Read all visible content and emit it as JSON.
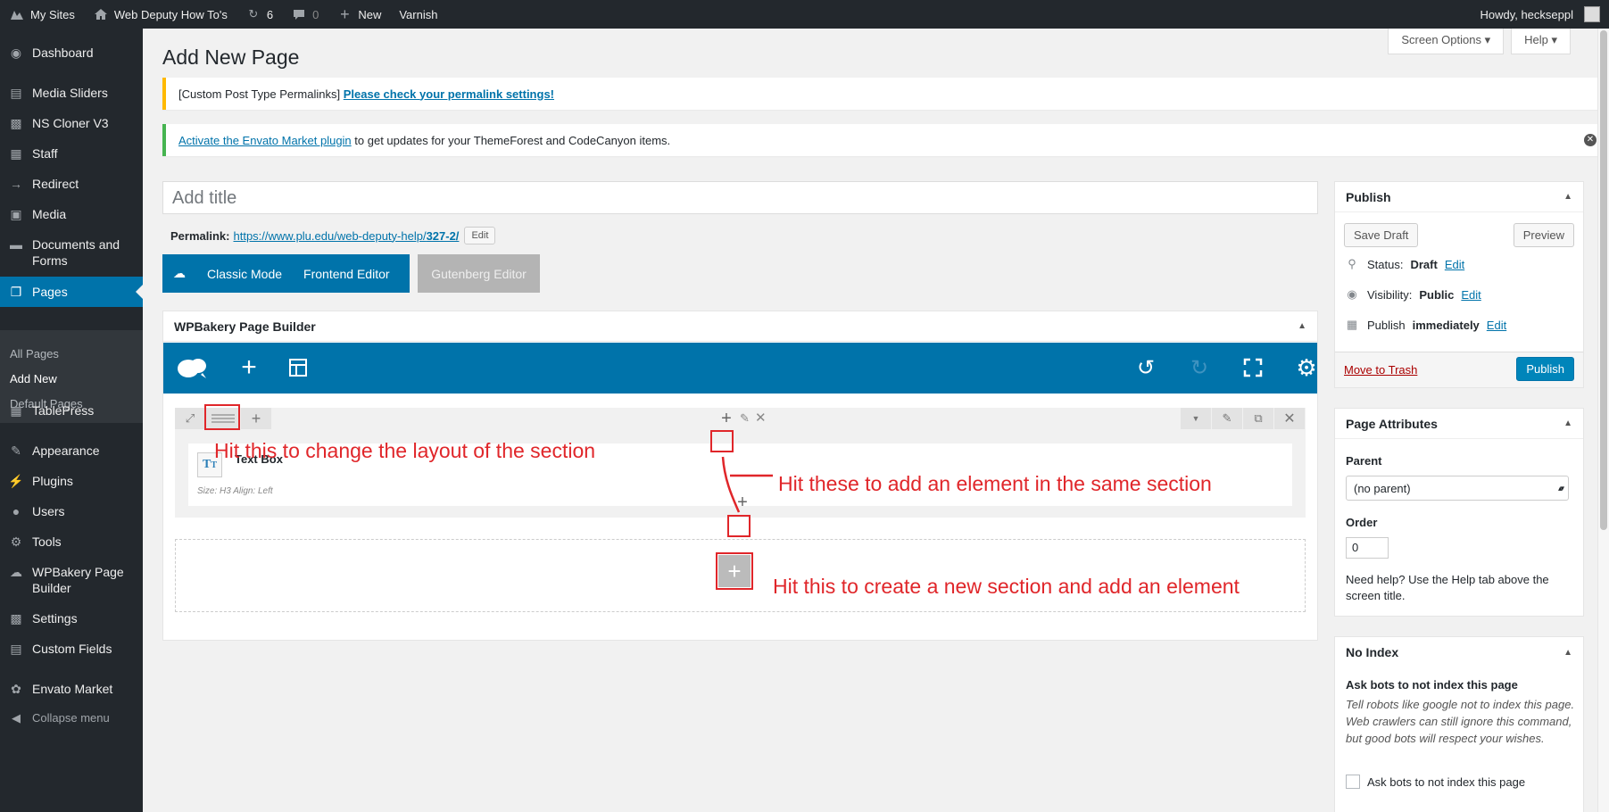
{
  "adminbar": {
    "my_sites": "My Sites",
    "site_name": "Web Deputy How To's",
    "updates_count": "6",
    "comments_count": "0",
    "new_label": "New",
    "varnish": "Varnish",
    "howdy": "Howdy, heckseppl"
  },
  "sidebar": {
    "items": [
      {
        "label": "Dashboard",
        "icon": "dashboard-icon"
      },
      {
        "label": "Media Sliders",
        "icon": "sliders-icon"
      },
      {
        "label": "NS Cloner V3",
        "icon": "cloner-icon"
      },
      {
        "label": "Staff",
        "icon": "staff-icon"
      },
      {
        "label": "Redirect",
        "icon": "arrow-right-icon"
      },
      {
        "label": "Media",
        "icon": "media-icon"
      },
      {
        "label": "Documents and Forms",
        "icon": "folder-icon"
      },
      {
        "label": "Pages",
        "icon": "pages-icon"
      },
      {
        "label": "TablePress",
        "icon": "table-icon"
      },
      {
        "label": "Appearance",
        "icon": "brush-icon"
      },
      {
        "label": "Plugins",
        "icon": "plugin-icon"
      },
      {
        "label": "Users",
        "icon": "users-icon"
      },
      {
        "label": "Tools",
        "icon": "wrench-icon"
      },
      {
        "label": "WPBakery Page Builder",
        "icon": "cloud-icon"
      },
      {
        "label": "Settings",
        "icon": "settings-icon"
      },
      {
        "label": "Custom Fields",
        "icon": "fields-icon"
      },
      {
        "label": "Envato Market",
        "icon": "leaf-icon"
      }
    ],
    "submenu": [
      "All Pages",
      "Add New",
      "Default Pages"
    ],
    "collapse": "Collapse menu"
  },
  "main": {
    "screen_options": "Screen Options",
    "help": "Help",
    "page_title": "Add New Page",
    "notice1_prefix": "[Custom Post Type Permalinks]",
    "notice1_link": "Please check your permalink settings!",
    "notice2_link": "Activate the Envato Market plugin",
    "notice2_text": "to get updates for your ThemeForest and CodeCanyon items.",
    "title_placeholder": "Add title",
    "permalink_label": "Permalink:",
    "permalink_url": "https://www.plu.edu/web-deputy-help/",
    "permalink_slug": "327-2/",
    "permalink_edit": "Edit",
    "classic_mode": "Classic Mode",
    "frontend_editor": "Frontend Editor",
    "gutenberg_editor": "Gutenberg Editor"
  },
  "wpbakery": {
    "title": "WPBakery Page Builder",
    "element_title": "Text Box",
    "element_meta": "Size: H3  Align: Left"
  },
  "annotations": {
    "layout": "Hit this to change the layout of the section",
    "add_same": "Hit these to add an element in the same section",
    "new_section": "Hit this to create a new section and add an element"
  },
  "publish": {
    "title": "Publish",
    "save_draft": "Save Draft",
    "preview": "Preview",
    "status_label": "Status:",
    "status_value": "Draft",
    "visibility_label": "Visibility:",
    "visibility_value": "Public",
    "publish_label": "Publish",
    "publish_value": "immediately",
    "edit": "Edit",
    "trash": "Move to Trash",
    "publish_button": "Publish"
  },
  "attributes": {
    "title": "Page Attributes",
    "parent_label": "Parent",
    "parent_value": "(no parent)",
    "order_label": "Order",
    "order_value": "0",
    "help": "Need help? Use the Help tab above the screen title."
  },
  "noindex": {
    "title": "No Index",
    "heading": "Ask bots to not index this page",
    "desc": "Tell robots like google not to index this page. Web crawlers can still ignore this command, but good bots will respect your wishes.",
    "checkbox_label": "Ask bots to not index this page"
  },
  "colors": {
    "accent": "#0073aa",
    "annotation": "#e0262a",
    "sidebar": "#23282d"
  }
}
